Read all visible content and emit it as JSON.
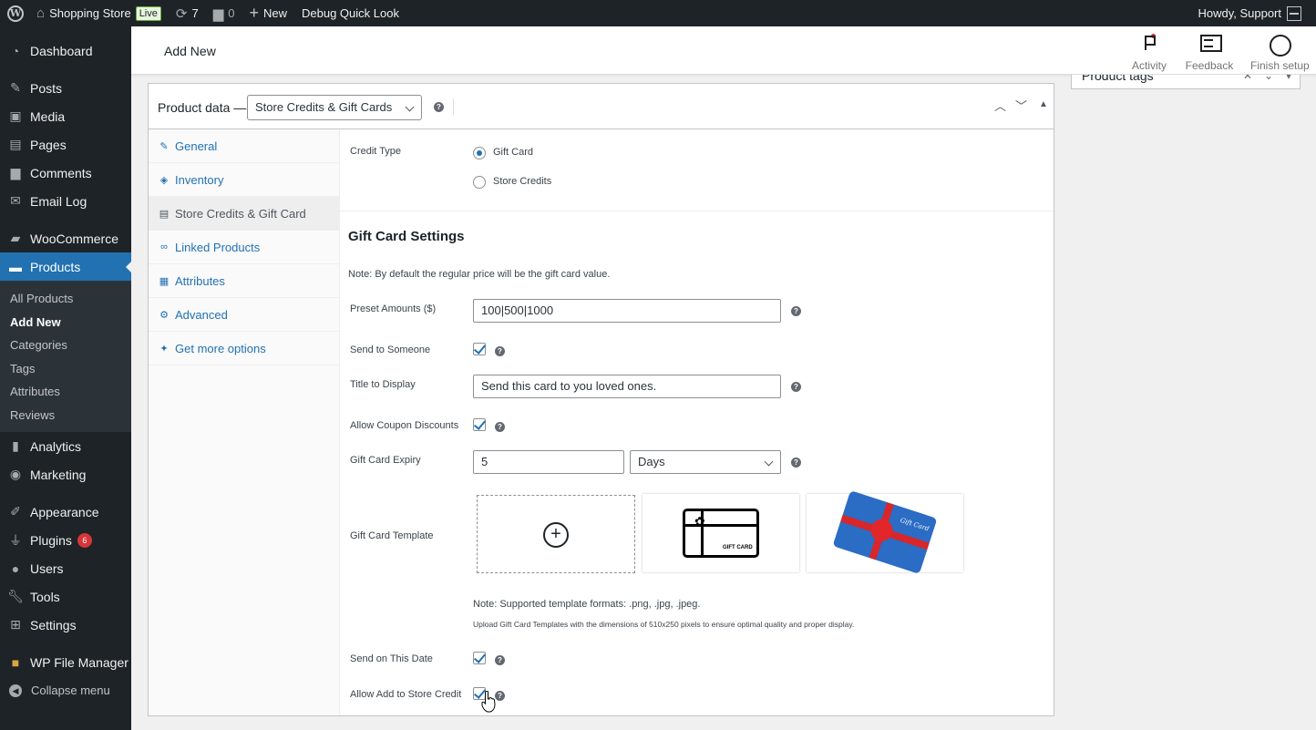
{
  "adminbar": {
    "site_name": "Shopping Store",
    "live_label": "Live",
    "updates_count": "7",
    "comments_count": "0",
    "new_label": "New",
    "debug_label": "Debug Quick Look",
    "howdy": "Howdy, Support"
  },
  "sidebar": {
    "items": [
      {
        "label": "Dashboard",
        "icon": "dashboard-icon"
      },
      {
        "label": "Posts",
        "icon": "pin-icon"
      },
      {
        "label": "Media",
        "icon": "media-icon"
      },
      {
        "label": "Pages",
        "icon": "pages-icon"
      },
      {
        "label": "Comments",
        "icon": "comment-icon"
      },
      {
        "label": "Email Log",
        "icon": "email-icon"
      },
      {
        "label": "WooCommerce",
        "icon": "woo-icon"
      },
      {
        "label": "Products",
        "icon": "archive-icon"
      },
      {
        "label": "Analytics",
        "icon": "chart-icon"
      },
      {
        "label": "Marketing",
        "icon": "megaphone-icon"
      },
      {
        "label": "Appearance",
        "icon": "brush-icon"
      },
      {
        "label": "Plugins",
        "icon": "plugin-icon"
      },
      {
        "label": "Users",
        "icon": "users-icon"
      },
      {
        "label": "Tools",
        "icon": "wrench-icon"
      },
      {
        "label": "Settings",
        "icon": "settings-icon"
      },
      {
        "label": "WP File Manager",
        "icon": "folder-icon"
      },
      {
        "label": "Collapse menu",
        "icon": "collapse-icon"
      }
    ],
    "plugins_badge": "6",
    "submenu": [
      "All Products",
      "Add New",
      "Categories",
      "Tags",
      "Attributes",
      "Reviews"
    ]
  },
  "header": {
    "title": "Add New",
    "activity": "Activity",
    "feedback": "Feedback",
    "finish_setup": "Finish setup"
  },
  "tags_box": {
    "title": "Product tags"
  },
  "product_data": {
    "label": "Product data —",
    "type_selected": "Store Credits & Gift Cards",
    "tabs": [
      "General",
      "Inventory",
      "Store Credits & Gift Card",
      "Linked Products",
      "Attributes",
      "Advanced",
      "Get more options"
    ],
    "credit_type_label": "Credit Type",
    "credit_options": [
      "Gift Card",
      "Store Credits"
    ],
    "section_title": "Gift Card Settings",
    "section_note": "Note: By default the regular price will be the gift card value.",
    "preset_label": "Preset Amounts ($)",
    "preset_value": "100|500|1000",
    "send_someone_label": "Send to Someone",
    "title_display_label": "Title to Display",
    "title_display_value": "Send this card to you loved ones.",
    "coupon_label": "Allow Coupon Discounts",
    "expiry_label": "Gift Card Expiry",
    "expiry_value": "5",
    "expiry_unit": "Days",
    "template_label": "Gift Card Template",
    "template_card_text": "GIFT CARD",
    "template_photo_text": "Gift Card",
    "template_note": "Note: Supported template formats: .png, .jpg, .jpeg.",
    "template_note2": "Upload Gift Card Templates with the dimensions of 510x250 pixels to ensure optimal quality and proper display.",
    "send_date_label": "Send on This Date",
    "store_credit_label": "Allow Add to Store Credit"
  },
  "colors": {
    "accent": "#2271b1",
    "sidebar_bg": "#1d2327",
    "badge": "#d63638"
  }
}
